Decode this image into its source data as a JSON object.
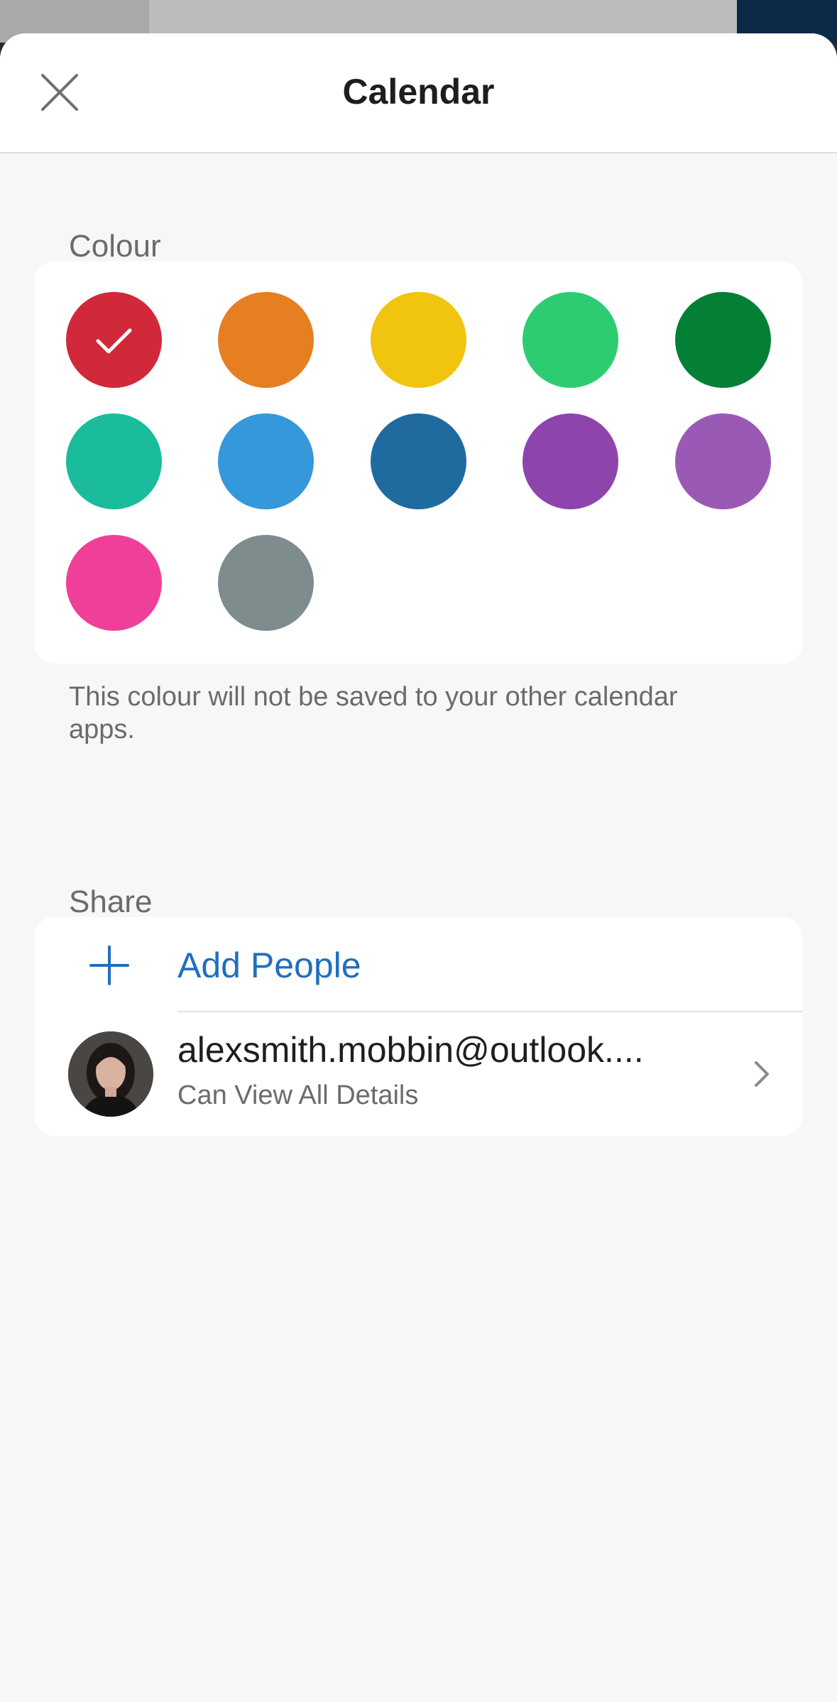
{
  "header": {
    "title": "Calendar",
    "close_icon": "close-icon"
  },
  "colour_section": {
    "label": "Colour",
    "selected_index": 0,
    "swatches": [
      {
        "name": "red",
        "color": "#d1293a",
        "selected": true
      },
      {
        "name": "orange",
        "color": "#e67e22",
        "selected": false
      },
      {
        "name": "yellow",
        "color": "#f1c40f",
        "selected": false
      },
      {
        "name": "light-green",
        "color": "#2ecc71",
        "selected": false
      },
      {
        "name": "dark-green",
        "color": "#038036",
        "selected": false
      },
      {
        "name": "teal",
        "color": "#1abc9c",
        "selected": false
      },
      {
        "name": "light-blue",
        "color": "#3498db",
        "selected": false
      },
      {
        "name": "dark-blue",
        "color": "#1f6ba0",
        "selected": false
      },
      {
        "name": "purple",
        "color": "#8e44ad",
        "selected": false
      },
      {
        "name": "lavender",
        "color": "#9b59b6",
        "selected": false
      },
      {
        "name": "pink",
        "color": "#f03f99",
        "selected": false
      },
      {
        "name": "grey",
        "color": "#7f8c8d",
        "selected": false
      }
    ],
    "footnote": "This colour will not be saved to your other calendar apps."
  },
  "share_section": {
    "label": "Share",
    "add_people_label": "Add People",
    "add_icon": "plus-icon",
    "people": [
      {
        "email": "alexsmith.mobbin@outlook....",
        "permission": "Can View All Details",
        "chevron_icon": "chevron-right-icon"
      }
    ]
  },
  "colors": {
    "accent": "#1f6fbf",
    "background": "#f7f7f7",
    "card": "#ffffff",
    "secondary_text": "#6b6b6b"
  }
}
